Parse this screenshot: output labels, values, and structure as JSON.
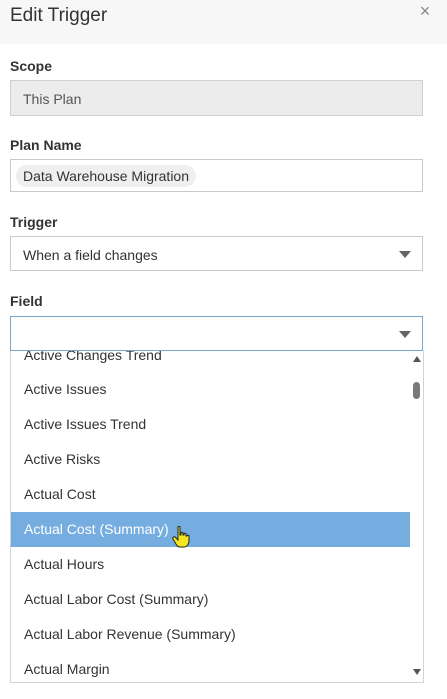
{
  "dialog": {
    "title": "Edit Trigger",
    "close_label": "×"
  },
  "scope": {
    "label": "Scope",
    "value": "This Plan"
  },
  "plan_name": {
    "label": "Plan Name",
    "value": "Data Warehouse Migration"
  },
  "trigger": {
    "label": "Trigger",
    "value": "When a field changes"
  },
  "field": {
    "label": "Field",
    "value": "",
    "options": [
      "Active Changes Trend",
      "Active Issues",
      "Active Issues Trend",
      "Active Risks",
      "Actual Cost",
      "Actual Cost (Summary)",
      "Actual Hours",
      "Actual Labor Cost (Summary)",
      "Actual Labor Revenue (Summary)",
      "Actual Margin"
    ],
    "highlighted": "Actual Cost (Summary)"
  },
  "colors": {
    "highlight": "#76ade0",
    "header_bg": "#f7f7f7",
    "focus_border": "#7ba6c9"
  },
  "icons": {
    "close": "close-icon",
    "dropdown": "chevron-down-icon",
    "scroll_up": "scroll-up-arrow-icon",
    "scroll_down": "scroll-down-arrow-icon",
    "pointer": "hand-cursor-icon"
  }
}
